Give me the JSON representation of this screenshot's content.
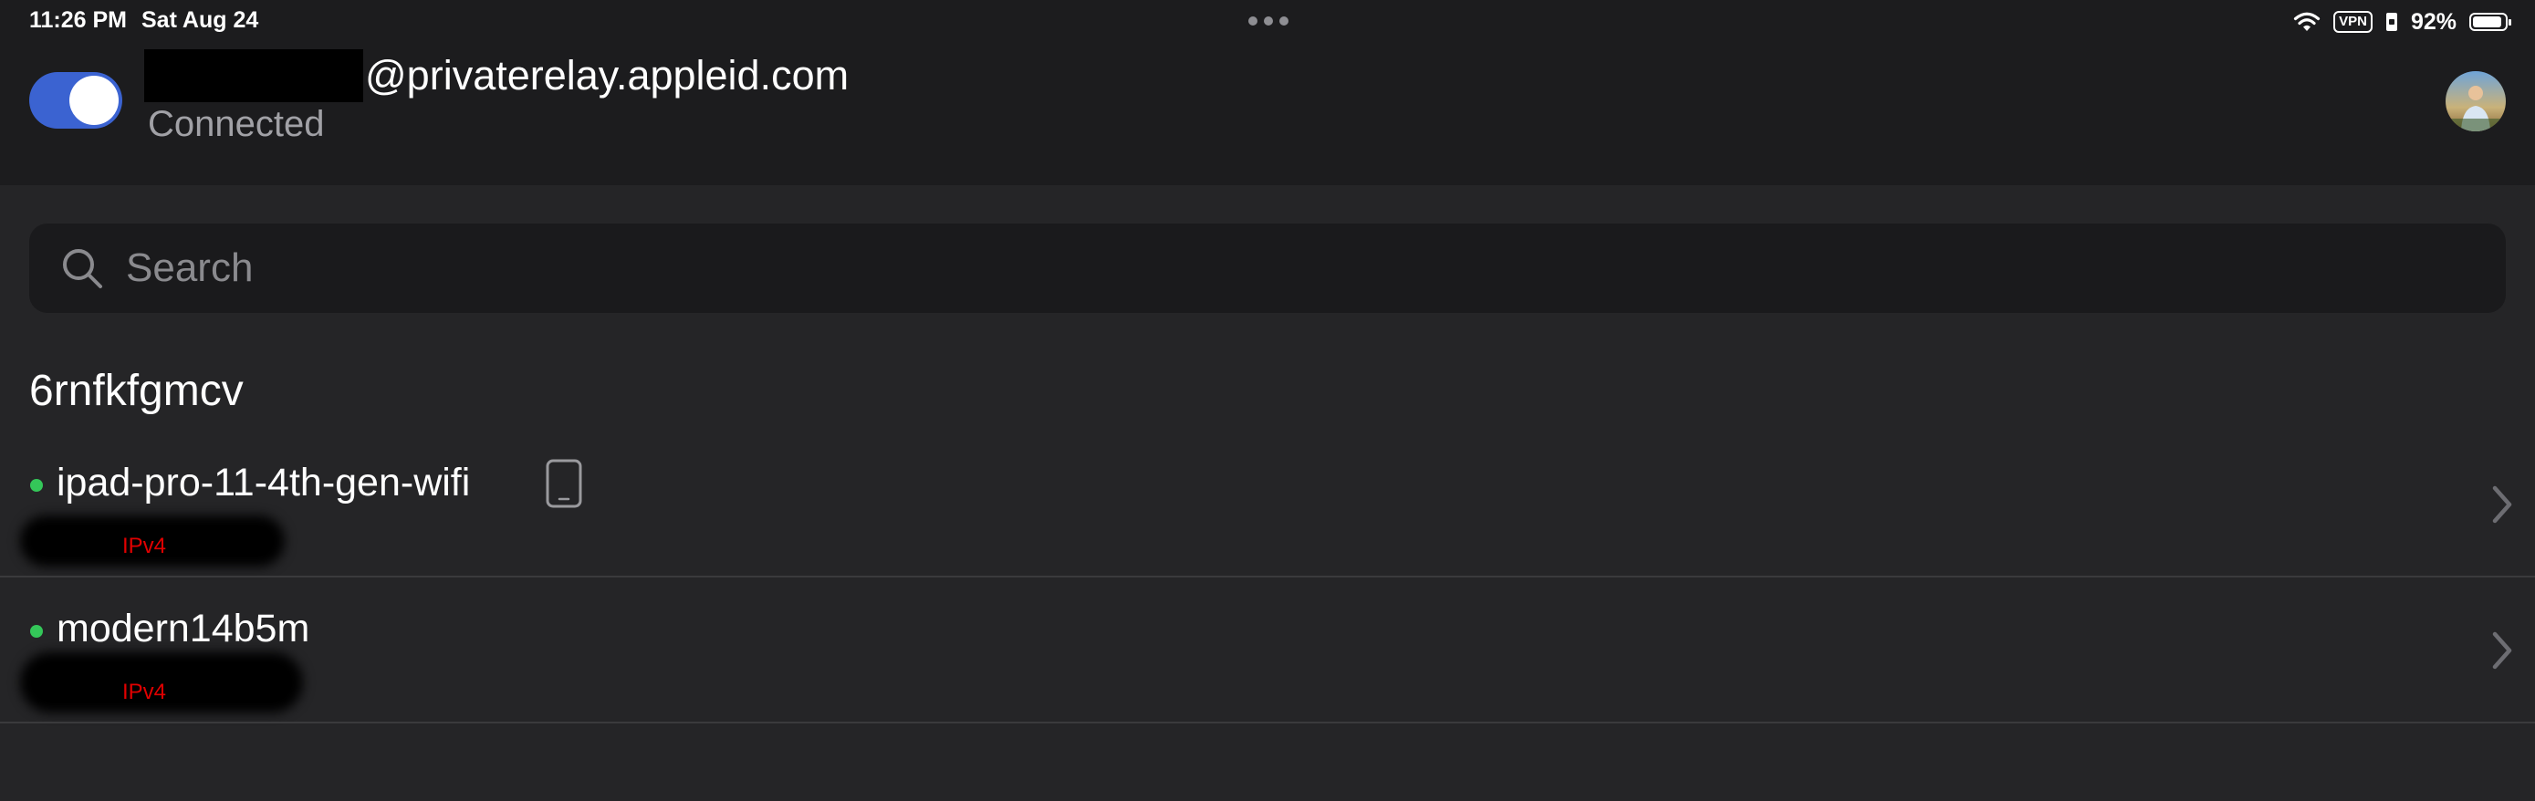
{
  "status_bar": {
    "time": "11:26 PM",
    "date": "Sat Aug 24",
    "vpn_label": "VPN",
    "battery_percent": "92%",
    "battery_level": 0.92
  },
  "header": {
    "email_domain": "@privaterelay.appleid.com",
    "connection_status": "Connected",
    "vpn_enabled": true,
    "toggle_color": "#3b63d1"
  },
  "search": {
    "placeholder": "Search",
    "value": ""
  },
  "tailnet": {
    "name": "6rnfkfgmcv",
    "devices": [
      {
        "name": "ipad-pro-11-4th-gen-wifi",
        "ip_label": "IPv4",
        "online": true,
        "is_this_device": true,
        "icon": "tablet-icon"
      },
      {
        "name": "modern14b5m",
        "ip_label": "IPv4",
        "online": true,
        "is_this_device": false
      }
    ]
  },
  "colors": {
    "online": "#34c759",
    "ip_label": "#e00000",
    "background": "#1c1c1e",
    "content_background": "#252527"
  }
}
